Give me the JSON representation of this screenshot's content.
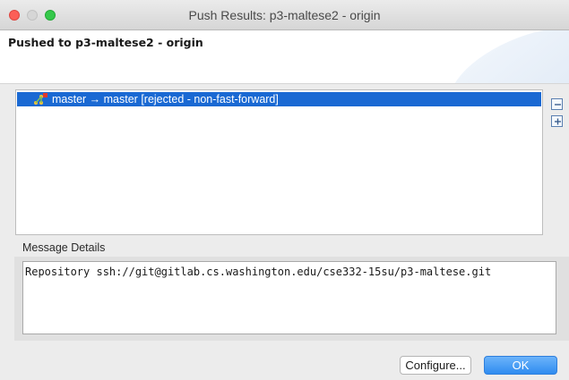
{
  "window": {
    "title": "Push Results: p3-maltese2 - origin"
  },
  "header": {
    "title": "Pushed to p3-maltese2 - origin"
  },
  "results": {
    "rows": [
      {
        "label": "master → master [rejected - non-fast-forward]",
        "icon": "git-branch-rejected-icon",
        "selected": true
      }
    ]
  },
  "toolbar": {
    "collapse_icon": "collapse-all-icon",
    "expand_icon": "expand-all-icon"
  },
  "details": {
    "label": "Message Details",
    "text": "Repository ssh://git@gitlab.cs.washington.edu/cse332-15su/p3-maltese.git"
  },
  "buttons": {
    "configure": "Configure...",
    "ok": "OK"
  },
  "colors": {
    "selection": "#1a69d3",
    "ok_button": "#3d94f6"
  }
}
